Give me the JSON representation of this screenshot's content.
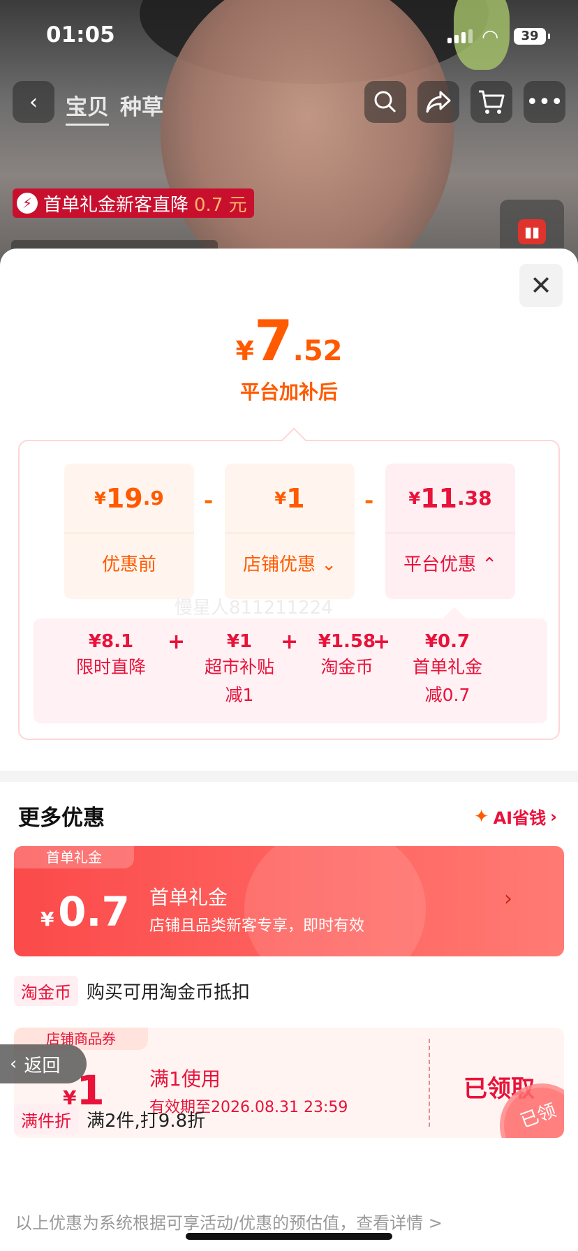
{
  "status": {
    "time": "01:05",
    "battery": "39"
  },
  "nav": {
    "tabs": [
      "宝贝",
      "种草"
    ],
    "icons": [
      "back-icon",
      "search-icon",
      "share-icon",
      "cart-icon",
      "more-icon"
    ]
  },
  "promo_tag": {
    "text": "首单礼金新客直降",
    "amount": "0.7 元"
  },
  "sheet": {
    "price": {
      "yen": "¥",
      "integer": "7",
      "decimal": ".52"
    },
    "price_note": "平台加补后",
    "cards": [
      {
        "yen": "¥",
        "big": "19",
        "small": ".9",
        "label": "优惠前"
      },
      {
        "yen": "¥",
        "big": "1",
        "small": "",
        "label": "店铺优惠",
        "chevron": "⌄"
      },
      {
        "yen": "¥",
        "big": "11",
        "small": ".38",
        "label": "平台优惠",
        "chevron": "⌃"
      }
    ],
    "minus": "-",
    "breakdown": [
      {
        "value": "¥8.1",
        "label": "限时直降",
        "sub": ""
      },
      {
        "value": "¥1",
        "label": "超市补贴",
        "sub": "减1"
      },
      {
        "value": "¥1.58",
        "label": "淘金币",
        "sub": ""
      },
      {
        "value": "¥0.7",
        "label": "首单礼金",
        "sub": "减0.7"
      }
    ],
    "plus": "+",
    "watermark": "慢星人811211224",
    "more_title": "更多优惠",
    "ai_link": "AI省钱",
    "gift": {
      "tag": "首单礼金",
      "yen": "¥",
      "amount": "0.7",
      "title": "首单礼金",
      "desc": "店铺且品类新客专享，即时有效"
    },
    "taojinbi": {
      "chip": "淘金币",
      "text": "购买可用淘金币抵扣"
    },
    "coupon": {
      "tag": "店铺商品券",
      "yen": "¥",
      "amount": "1",
      "title": "满1使用",
      "desc": "有效期至2026.08.31 23:59",
      "claimed": "已领取",
      "stamp": "已领"
    },
    "discount": {
      "chip": "满件折",
      "text": "满2件,打9.8折"
    },
    "footer": "以上优惠为系统根据可享活动/优惠的预估值，查看详情 >",
    "back_label": "返回"
  },
  "colors": {
    "accent_orange": "#ff5a00",
    "accent_red": "#e8123a"
  }
}
